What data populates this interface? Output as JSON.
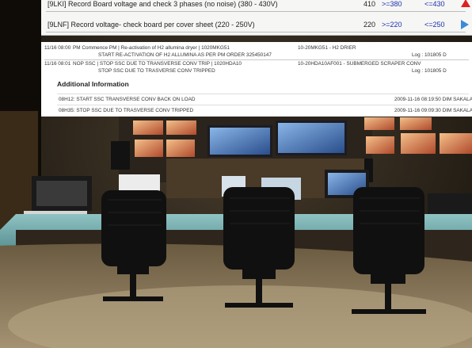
{
  "readings": [
    {
      "label": "[9LKI] Record Board voltage and check 3 phases (no noise) (380 - 430V)",
      "value": "410",
      "min": ">=380",
      "max": "<=430",
      "indicator": "red-up-triangle"
    },
    {
      "label": "[9LNF] Record voltage- check board per cover sheet (220 - 250V)",
      "value": "220",
      "min": ">=220",
      "max": "<=250",
      "indicator": "blue-right-triangle"
    }
  ],
  "log_entries": [
    {
      "time": "11/16 08:00",
      "line1": "PM Commence PM | Re-activation of H2 allumina dryer | 1020MKG51",
      "tag": "10-20MKG51 - H2 DRIER",
      "line2": "START RE-ACTIVATION OF H2 ALLUMINA AS PER PM ORDER 325450147",
      "log": "Log : 101805  D"
    },
    {
      "time": "11/16 08:01",
      "line1": "NOP SSC | STOP SSC DUE TO TRANSVERSE CONV TRIP | 1020HDA10",
      "tag": "10-20HDA10AF001 - SUBMERGED SCRAPER CONV",
      "line2": "STOP SSC DUE TO TRASVERSE CONV TRIPPED",
      "log": "Log : 101805  D"
    }
  ],
  "additional_info": {
    "title": "Additional Information",
    "items": [
      {
        "text": "08H12: START SSC TRANSVERSE CONV BACK ON LOAD",
        "datetime": "2009-11-16 08:19:50  DIM SAKALA"
      },
      {
        "text": "08H35: STOP SSC DUE TO TRASVERSE CONV TRIPPED",
        "datetime": "2009-11-16 09:09:30  DIM SAKALA"
      }
    ]
  },
  "colors": {
    "limit_text": "#1a2fb0",
    "alarm": "#e02020",
    "ok_arrow": "#3a8ad8"
  }
}
